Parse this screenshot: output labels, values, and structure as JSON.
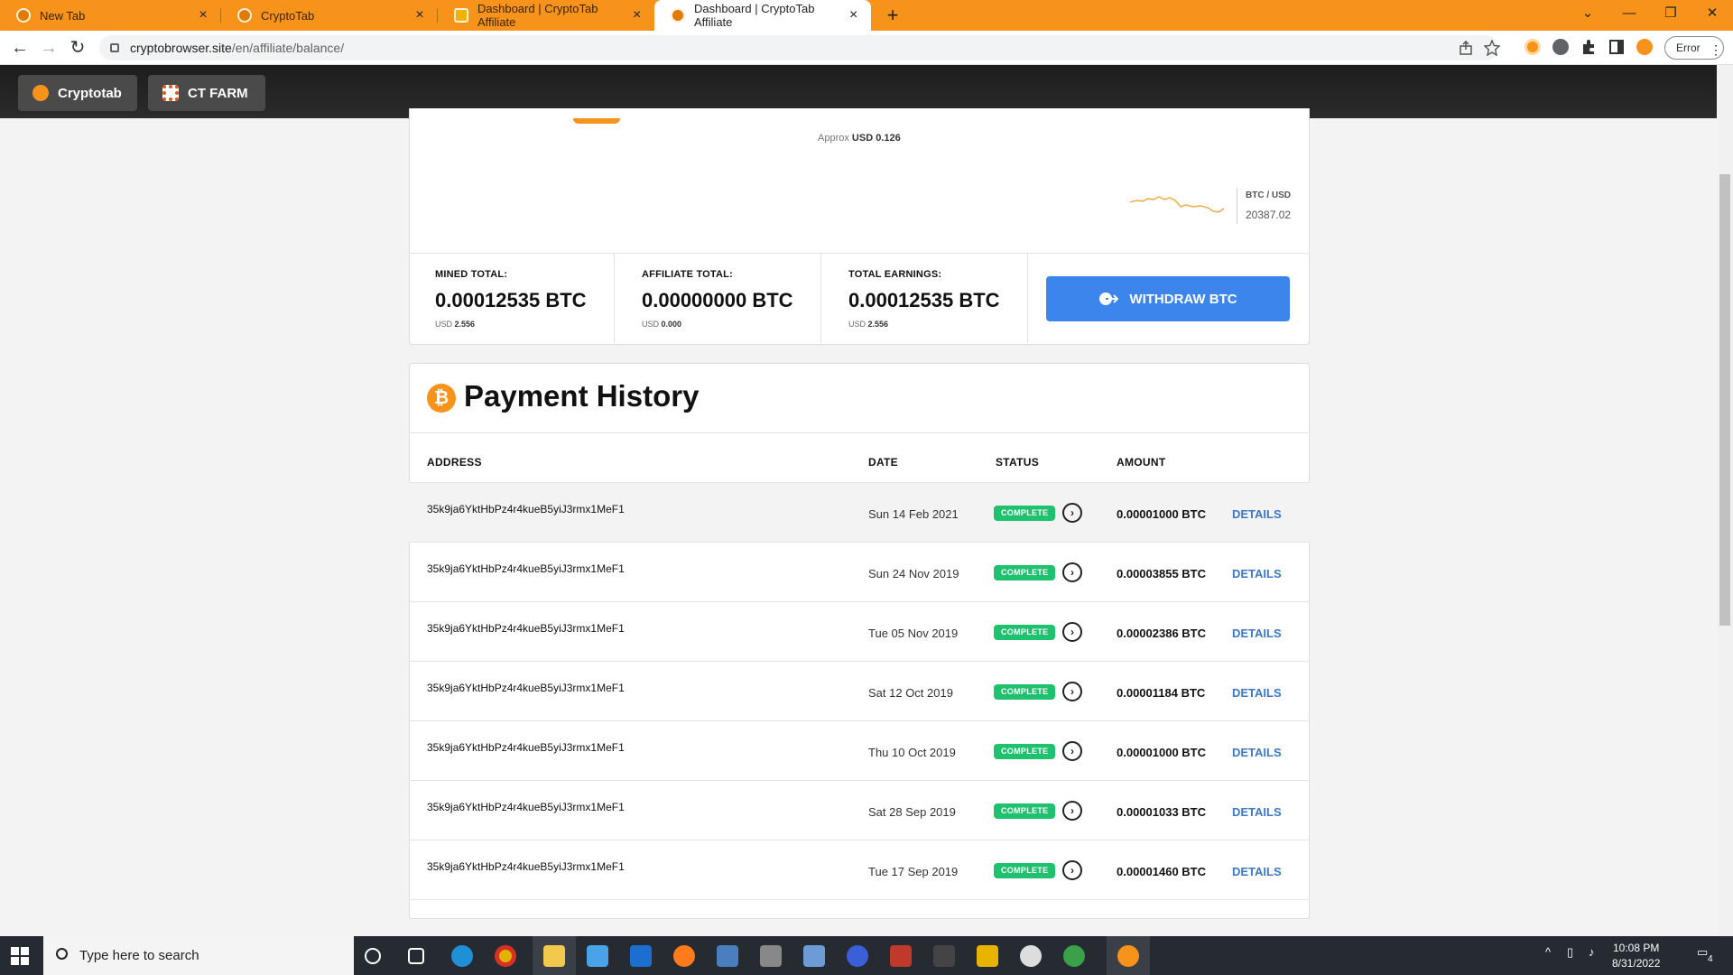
{
  "browser": {
    "tabs": [
      {
        "title": "New Tab",
        "close": "×"
      },
      {
        "title": "CryptoTab",
        "close": "×"
      },
      {
        "title": "Dashboard | CryptoTab Affiliate",
        "close": "×"
      },
      {
        "title": "Dashboard | CryptoTab Affiliate",
        "close": "×"
      }
    ],
    "new_tab": "+",
    "url_host": "cryptobrowser.site",
    "url_path": "/en/affiliate/balance/",
    "profile_button": "Error",
    "window_controls": {
      "chevron": "⌄",
      "minimize": "—",
      "restore": "❐",
      "close": "✕"
    },
    "nav": {
      "back": "←",
      "forward": "→",
      "reload": "↻"
    }
  },
  "header": {
    "cryptotab_label": "Cryptotab",
    "ctfarm_label": "CT FARM"
  },
  "balance": {
    "approx_prefix": "Approx",
    "approx_value": "USD 0.126",
    "chart_label": "BTC / USD",
    "chart_value": "20387.02",
    "stats": [
      {
        "label": "MINED TOTAL:",
        "value": "0.00012535 BTC",
        "usd_prefix": "USD",
        "usd_value": "2.556"
      },
      {
        "label": "AFFILIATE TOTAL:",
        "value": "0.00000000 BTC",
        "usd_prefix": "USD",
        "usd_value": "0.000"
      },
      {
        "label": "TOTAL EARNINGS:",
        "value": "0.00012535 BTC",
        "usd_prefix": "USD",
        "usd_value": "2.556"
      }
    ],
    "withdraw_label": "WITHDRAW BTC"
  },
  "history": {
    "title": "Payment History",
    "badge": "₿",
    "columns": {
      "address": "ADDRESS",
      "date": "DATE",
      "status": "STATUS",
      "amount": "AMOUNT"
    },
    "rows": [
      {
        "address": "35k9ja6YktHbPz4r4kueB5yiJ3rmx1MeF1",
        "date": "Sun 14 Feb 2021",
        "status": "COMPLETE",
        "amount": "0.00001000 BTC",
        "action": "DETAILS"
      },
      {
        "address": "35k9ja6YktHbPz4r4kueB5yiJ3rmx1MeF1",
        "date": "Sun 24 Nov 2019",
        "status": "COMPLETE",
        "amount": "0.00003855 BTC",
        "action": "DETAILS"
      },
      {
        "address": "35k9ja6YktHbPz4r4kueB5yiJ3rmx1MeF1",
        "date": "Tue 05 Nov 2019",
        "status": "COMPLETE",
        "amount": "0.00002386 BTC",
        "action": "DETAILS"
      },
      {
        "address": "35k9ja6YktHbPz4r4kueB5yiJ3rmx1MeF1",
        "date": "Sat 12 Oct 2019",
        "status": "COMPLETE",
        "amount": "0.00001184 BTC",
        "action": "DETAILS"
      },
      {
        "address": "35k9ja6YktHbPz4r4kueB5yiJ3rmx1MeF1",
        "date": "Thu 10 Oct 2019",
        "status": "COMPLETE",
        "amount": "0.00001000 BTC",
        "action": "DETAILS"
      },
      {
        "address": "35k9ja6YktHbPz4r4kueB5yiJ3rmx1MeF1",
        "date": "Sat 28 Sep 2019",
        "status": "COMPLETE",
        "amount": "0.00001033 BTC",
        "action": "DETAILS"
      },
      {
        "address": "35k9ja6YktHbPz4r4kueB5yiJ3rmx1MeF1",
        "date": "Tue 17 Sep 2019",
        "status": "COMPLETE",
        "amount": "0.00001460 BTC",
        "action": "DETAILS"
      }
    ]
  },
  "taskbar": {
    "search_placeholder": "Type here to search",
    "time": "10:08 PM",
    "date": "8/31/2022",
    "notification_count": "4"
  },
  "colors": {
    "tab_bar": "#f7931a",
    "withdraw_button": "#3c85ec",
    "status_complete": "#1ec26e",
    "details_link": "#3c79c7"
  }
}
